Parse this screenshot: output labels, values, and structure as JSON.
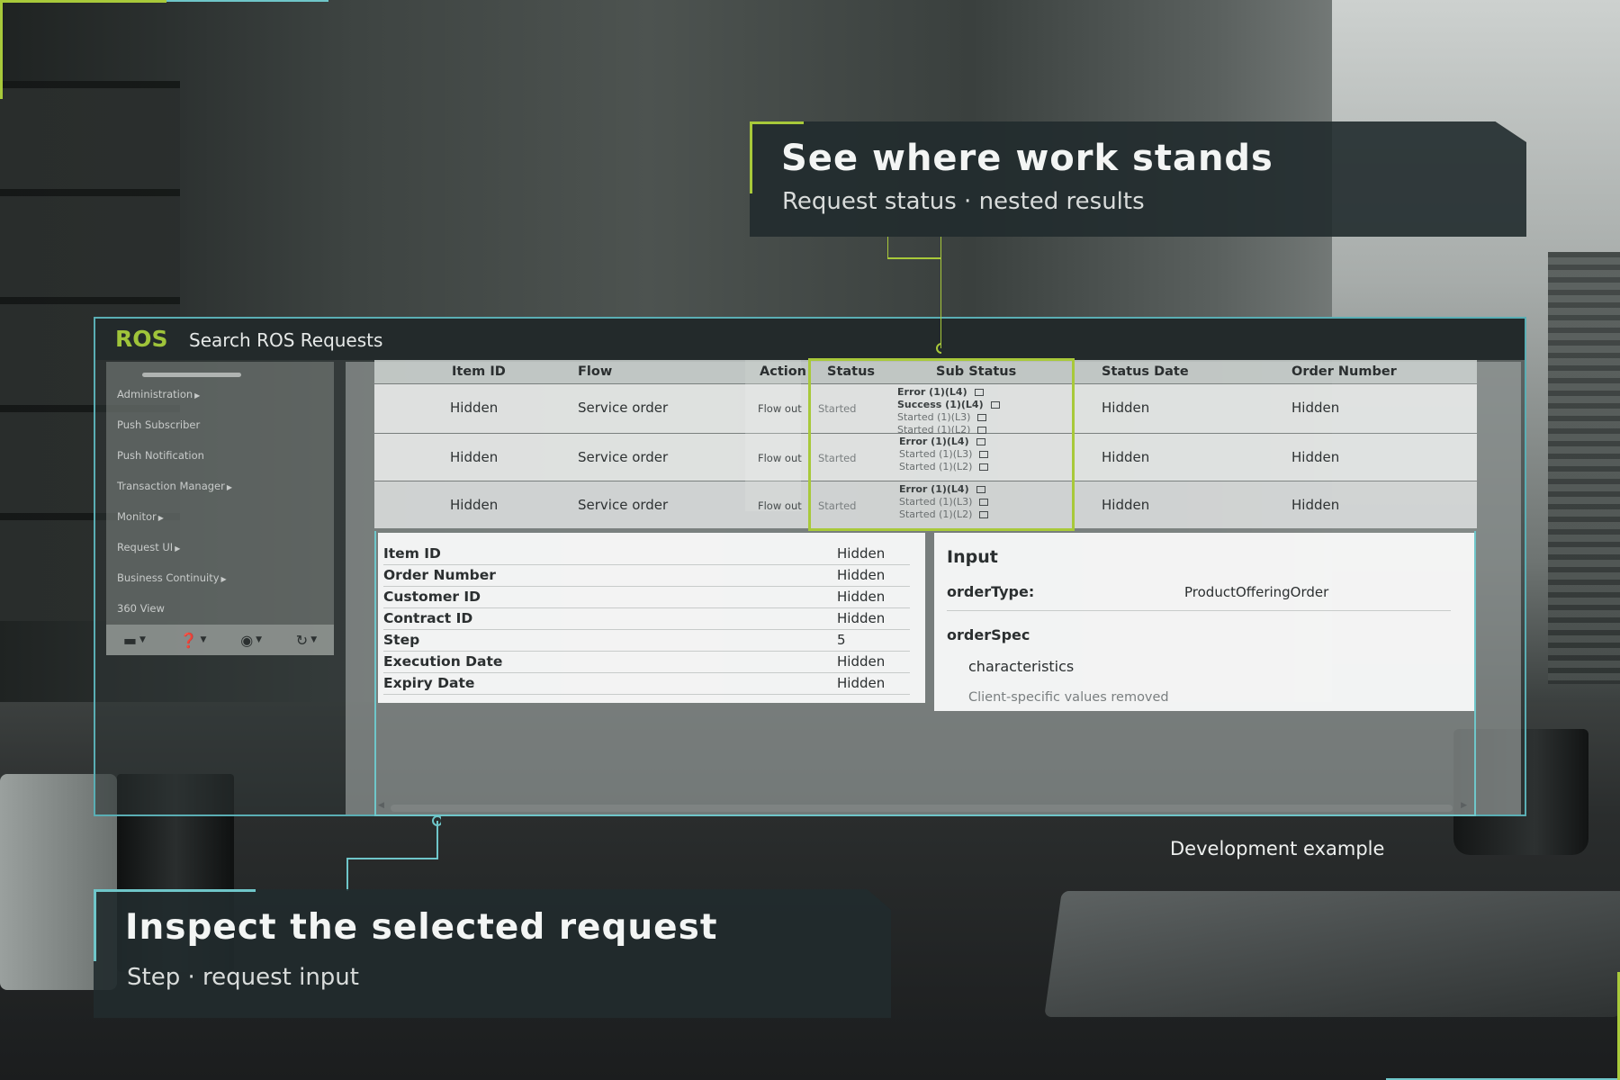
{
  "app": {
    "logo": "ROS",
    "title": "Search ROS Requests"
  },
  "sidebar": {
    "items": [
      {
        "label": "Administration"
      },
      {
        "label": "Push Subscriber"
      },
      {
        "label": "Push Notification"
      },
      {
        "label": "Transaction Manager"
      },
      {
        "label": "Monitor"
      },
      {
        "label": "Request UI"
      },
      {
        "label": "Business Continuity"
      },
      {
        "label": "360 View"
      }
    ],
    "tools": [
      "flag-icon",
      "help-icon",
      "user-icon",
      "refresh-icon"
    ]
  },
  "grid": {
    "columns": [
      "Item ID",
      "Flow",
      "Action",
      "Status",
      "Sub Status",
      "Status Date",
      "Order Number"
    ],
    "rows": [
      {
        "item_id": "Hidden",
        "flow": "Service order",
        "action": "Flow out",
        "status": "Started",
        "sub_status": [
          "Error (1)(L4)",
          "Success (1)(L4)",
          "Started (1)(L3)",
          "Started (1)(L2)"
        ],
        "status_date": "Hidden",
        "order_number": "Hidden"
      },
      {
        "item_id": "Hidden",
        "flow": "Service order",
        "action": "Flow out",
        "status": "Started",
        "sub_status": [
          "Error (1)(L4)",
          "Started (1)(L3)",
          "Started (1)(L2)"
        ],
        "status_date": "Hidden",
        "order_number": "Hidden"
      },
      {
        "item_id": "Hidden",
        "flow": "Service order",
        "action": "Flow out",
        "status": "Started",
        "sub_status": [
          "Error (1)(L4)",
          "Started (1)(L3)",
          "Started (1)(L2)"
        ],
        "status_date": "Hidden",
        "order_number": "Hidden"
      }
    ]
  },
  "detail": {
    "rows": [
      {
        "key": "Item ID",
        "value": "Hidden"
      },
      {
        "key": "Order Number",
        "value": "Hidden"
      },
      {
        "key": "Customer ID",
        "value": "Hidden"
      },
      {
        "key": "Contract ID",
        "value": "Hidden"
      },
      {
        "key": "Step",
        "value": "5"
      },
      {
        "key": "Execution Date",
        "value": "Hidden"
      },
      {
        "key": "Expiry Date",
        "value": "Hidden"
      }
    ]
  },
  "input": {
    "title": "Input",
    "order_type_key": "orderType:",
    "order_type_value": "ProductOfferingOrder",
    "order_spec": "orderSpec",
    "characteristics": "characteristics",
    "note": "Client-specific values removed"
  },
  "callouts": {
    "top_title": "See where work stands",
    "top_sub": "Request status · nested results",
    "bottom_title": "Inspect the selected request",
    "bottom_sub": "Step · request input"
  },
  "footer_note": "Development example",
  "colors": {
    "accent_green": "#a8c93a",
    "accent_teal": "#6fc6c9",
    "callout_bg": "#212b2d"
  }
}
